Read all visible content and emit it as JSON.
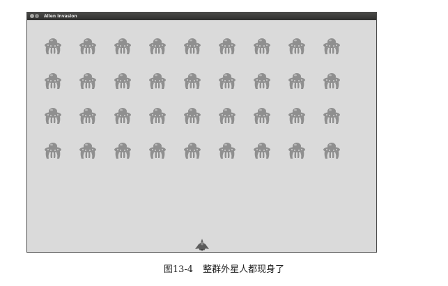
{
  "window": {
    "title": "Alien Invasion"
  },
  "game": {
    "alien_rows": 4,
    "aliens_per_row": 9,
    "alien_icon": "alien-ufo-icon",
    "ship_icon": "player-ship-icon",
    "colors": {
      "background": "#dadada",
      "alien": "#8f8f8f",
      "ship": "#5c5c5c",
      "titlebar": "#3a3a39"
    }
  },
  "caption": {
    "figure_number": "图13-4",
    "text": "整群外星人都现身了"
  }
}
